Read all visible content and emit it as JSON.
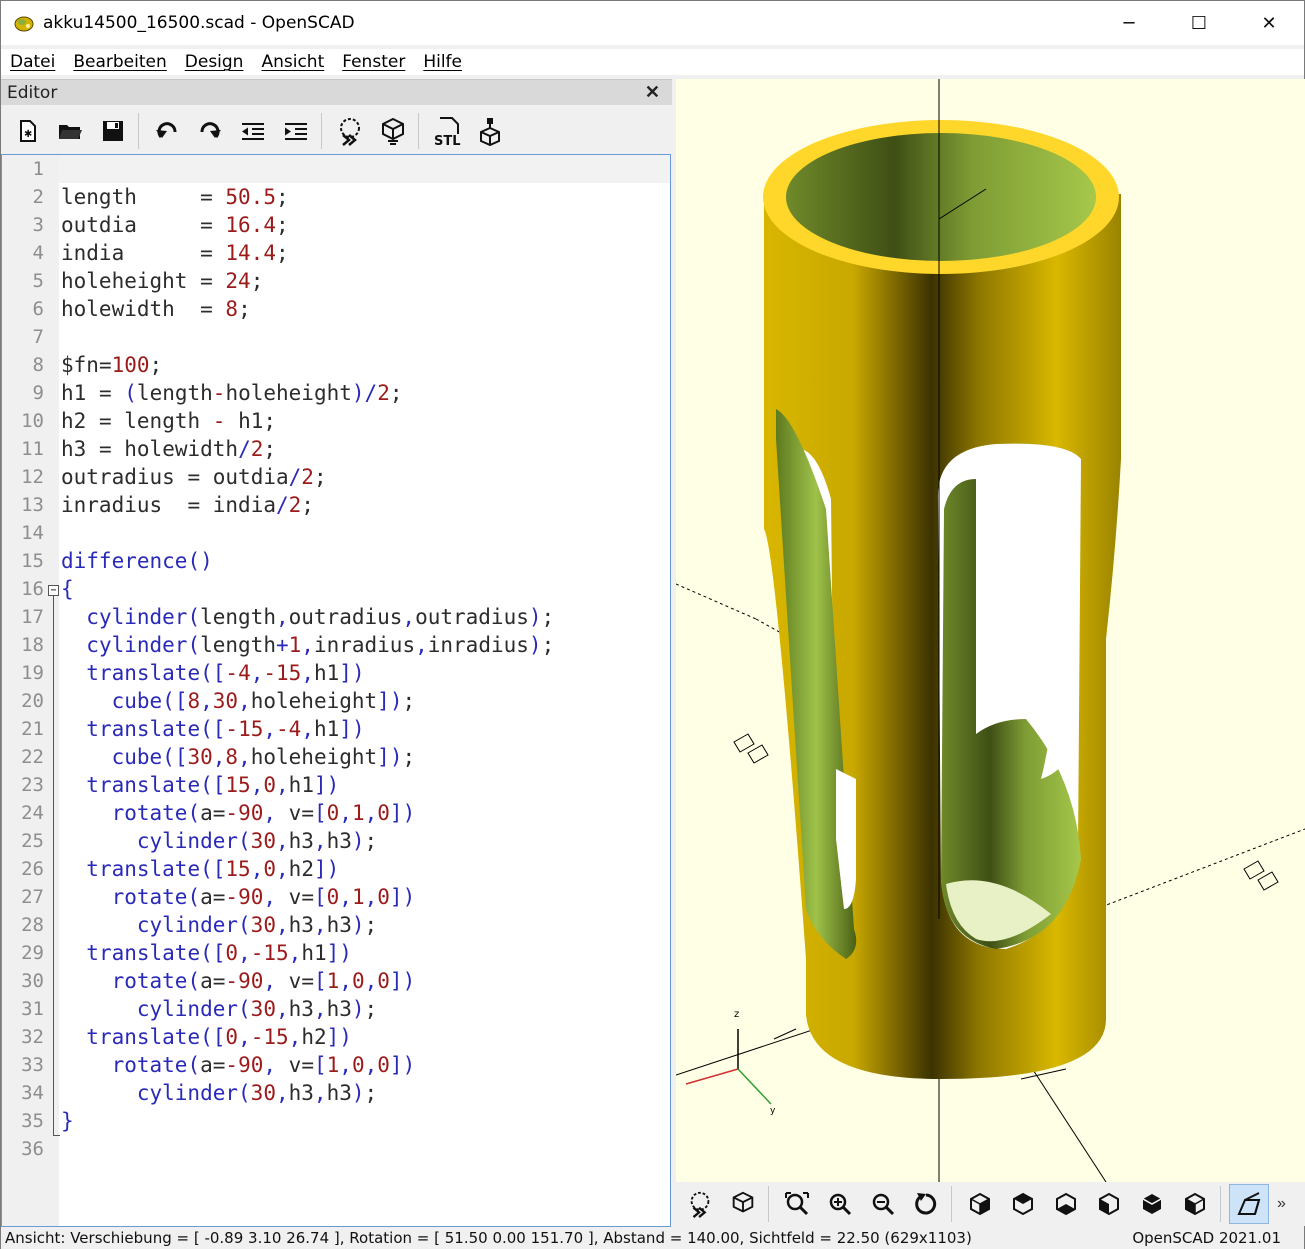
{
  "window": {
    "title": "akku14500_16500.scad - OpenSCAD",
    "minimize": "─",
    "maximize": "☐",
    "close": "✕"
  },
  "menu": [
    "Datei",
    "Bearbeiten",
    "Design",
    "Ansicht",
    "Fenster",
    "Hilfe"
  ],
  "editor": {
    "title": "Editor",
    "close": "✕",
    "toolbar": [
      "new-file-icon",
      "open-file-icon",
      "save-icon",
      "undo-icon",
      "redo-icon",
      "unindent-icon",
      "indent-icon",
      "preview-icon",
      "render-icon",
      "export-stl-icon",
      "send-to-printer-icon"
    ],
    "stl_label": "STL",
    "line_numbers": [
      "1",
      "2",
      "3",
      "4",
      "5",
      "6",
      "7",
      "8",
      "9",
      "10",
      "11",
      "12",
      "13",
      "14",
      "15",
      "16",
      "17",
      "18",
      "19",
      "20",
      "21",
      "22",
      "23",
      "24",
      "25",
      "26",
      "27",
      "28",
      "29",
      "30",
      "31",
      "32",
      "33",
      "34",
      "35",
      "36"
    ],
    "lines": [
      "",
      "length     = 50.5;",
      "outdia     = 16.4;",
      "india      = 14.4;",
      "holeheight = 24;",
      "holewidth  = 8;",
      "",
      "$fn=100;",
      "h1 = (length-holeheight)/2;",
      "h2 = length - h1;",
      "h3 = holewidth/2;",
      "outradius = outdia/2;",
      "inradius  = india/2;",
      "",
      "difference()",
      "{",
      "  cylinder(length,outradius,outradius);",
      "  cylinder(length+1,inradius,inradius);",
      "  translate([-4,-15,h1])",
      "    cube([8,30,holeheight]);",
      "  translate([-15,-4,h1])",
      "    cube([30,8,holeheight]);",
      "  translate([15,0,h1])",
      "    rotate(a=-90, v=[0,1,0])",
      "      cylinder(30,h3,h3);",
      "  translate([15,0,h2])",
      "    rotate(a=-90, v=[0,1,0])",
      "      cylinder(30,h3,h3);",
      "  translate([0,-15,h1])",
      "    rotate(a=-90, v=[1,0,0])",
      "      cylinder(30,h3,h3);",
      "  translate([0,-15,h2])",
      "    rotate(a=-90, v=[1,0,0])",
      "      cylinder(30,h3,h3);",
      "}",
      ""
    ],
    "colors": {
      "keyword": "#2a2ab8",
      "number": "#9b1b1b",
      "text": "#2c2c2c"
    }
  },
  "viewport": {
    "background": "#ffffe5",
    "model_outer_color": "#d4b300",
    "model_inner_color": "#8cae3a",
    "rim_color": "#ffd62a",
    "axis_labels": {
      "z": "z",
      "y": "y"
    },
    "toolbar": [
      "preview-icon",
      "render-icon",
      "view-all-icon",
      "zoom-in-icon",
      "zoom-out-icon",
      "reset-view-icon",
      "view-right-icon",
      "view-top-icon",
      "view-bottom-icon",
      "view-left-icon",
      "view-front-icon",
      "view-back-icon",
      "perspective-icon"
    ],
    "more": "»"
  },
  "status": {
    "left": "Ansicht: Verschiebung = [ -0.89 3.10 26.74 ], Rotation = [ 51.50 0.00 151.70 ], Abstand = 140.00, Sichtfeld = 22.50 (629x1103)",
    "right": "OpenSCAD 2021.01"
  }
}
